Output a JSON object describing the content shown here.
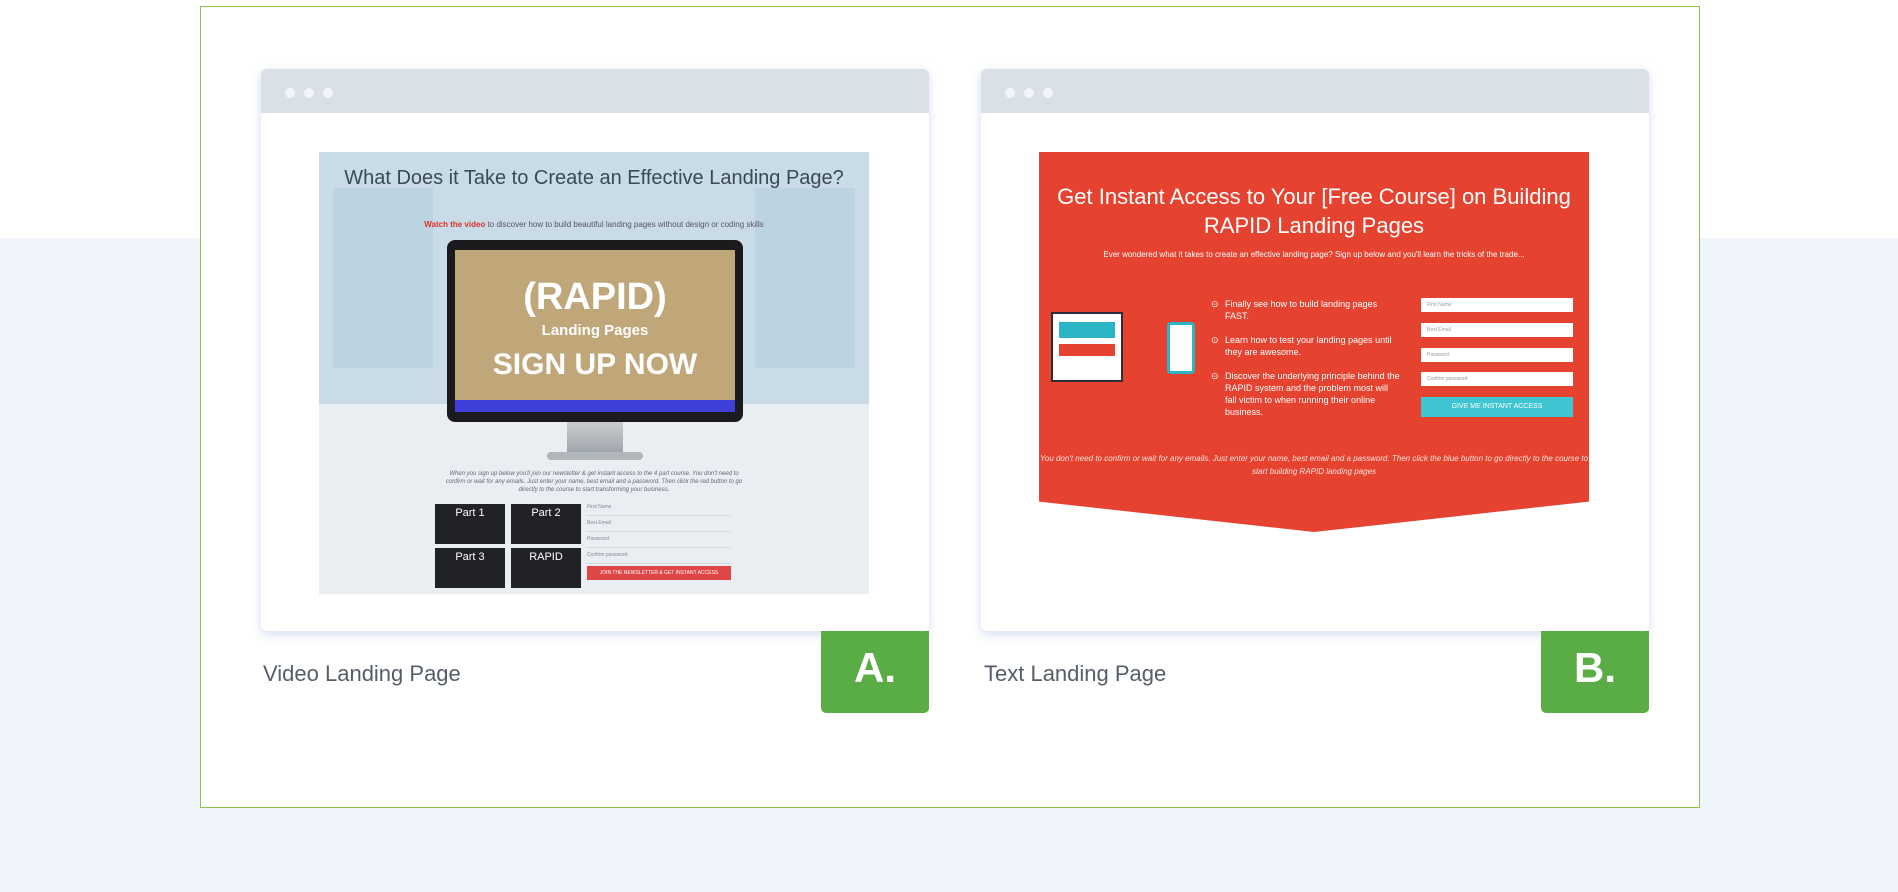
{
  "cards": [
    {
      "caption": "Video Landing Page",
      "badge": "A.",
      "preview": {
        "headline": "What Does it Take to Create an Effective Landing Page?",
        "sub_red": "Watch the video",
        "sub_rest": " to discover how to build beautiful landing pages without design or coding skills",
        "video_title": "(RAPID)",
        "video_sub": "Landing Pages",
        "video_cta": "SIGN UP NOW",
        "copy": "When you sign up below you'll join our newsletter & get instant access to the 4 part course. You don't need to confirm or wait for any emails. Just enter your name, best email and a password. Then click the red button to go directly to the course to start transforming your business.",
        "parts": [
          "Part 1",
          "Part 2",
          "Part 3",
          "RAPID"
        ],
        "fields": [
          "First Name",
          "Best Email",
          "Password",
          "Confirm password"
        ],
        "button": "JOIN THE NEWSLETTER & GET INSTANT ACCESS"
      }
    },
    {
      "caption": "Text Landing Page",
      "badge": "B.",
      "preview": {
        "headline": "Get Instant Access to Your [Free Course] on Building RAPID Landing Pages",
        "sub": "Ever wondered what it takes to create an effective landing page? Sign up below and you'll learn the tricks of the trade...",
        "bullets": [
          "Finally see how to build landing pages FAST.",
          "Learn how to test your landing pages until they are awesome.",
          "Discover the underlying principle behind the RAPID system and the problem most will fall victim to when running their online business."
        ],
        "fields": [
          "First Name",
          "Best Email",
          "Password",
          "Confirm password"
        ],
        "button": "GIVE ME INSTANT ACCESS",
        "footer": "You don't need to confirm or wait for any emails. Just enter your name, best email and a password. Then click the blue button to go directly to the course to start building RAPID landing pages"
      }
    }
  ]
}
